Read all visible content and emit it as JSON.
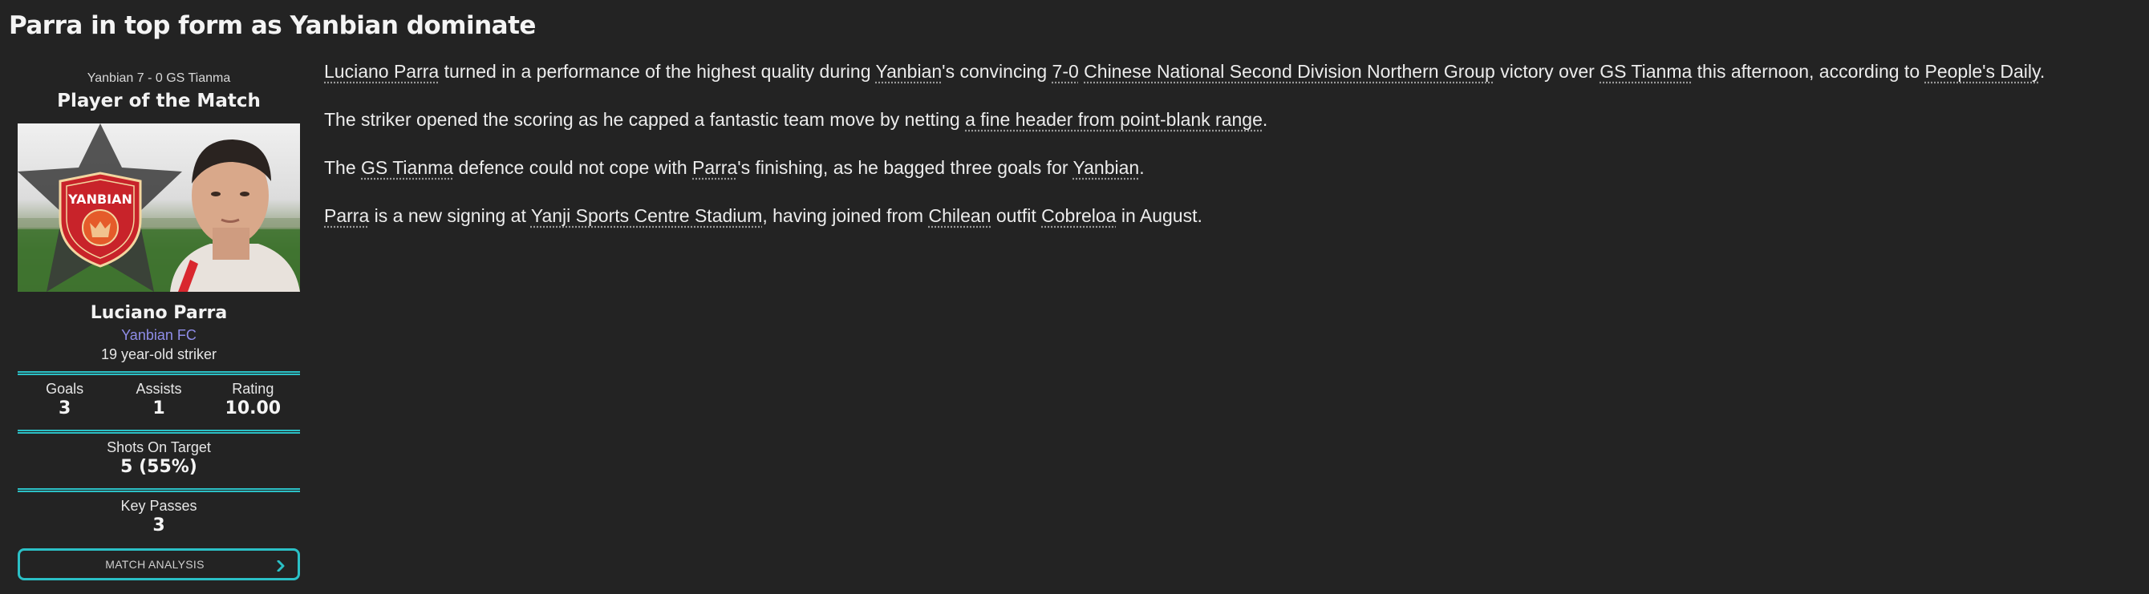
{
  "headline": "Parra in top form as Yanbian dominate",
  "sidebar": {
    "score_line": "Yanbian 7 - 0 GS Tianma",
    "award_title": "Player of the Match",
    "badge_text": "YANBIAN",
    "player_name": "Luciano Parra",
    "club": "Yanbian FC",
    "description": "19 year-old striker",
    "stats": {
      "goals_label": "Goals",
      "goals_value": "3",
      "assists_label": "Assists",
      "assists_value": "1",
      "rating_label": "Rating",
      "rating_value": "10.00",
      "shots_label": "Shots On Target",
      "shots_value": "5 (55%)",
      "key_passes_label": "Key Passes",
      "key_passes_value": "3"
    },
    "match_analysis_label": "MATCH ANALYSIS"
  },
  "article": {
    "p1": {
      "player": "Luciano Parra",
      "t1": " turned in a performance of the highest quality during ",
      "club": "Yanbian",
      "t2": "'s convincing ",
      "score": "7-0",
      "t3": " ",
      "competition": "Chinese National Second Division Northern Group",
      "t4": " victory over ",
      "opponent": "GS Tianma",
      "t5": " this afternoon, according to ",
      "source": "People's Daily",
      "t6": "."
    },
    "p2": {
      "t1": "The striker opened the scoring as he capped a fantastic team move by netting ",
      "goal_link": "a fine header from point-blank range",
      "t2": "."
    },
    "p3": {
      "t1": "The ",
      "opponent": "GS Tianma",
      "t2": " defence could not cope with ",
      "player": "Parra",
      "t3": "'s finishing, as he bagged three goals for ",
      "club": "Yanbian",
      "t4": "."
    },
    "p4": {
      "player": "Parra",
      "t1": " is a new signing at ",
      "stadium": "Yanji Sports Centre Stadium",
      "t2": ", having joined from ",
      "nation": "Chilean",
      "t3": " outfit ",
      "former_club": "Cobreloa",
      "t4": " in August."
    }
  },
  "colors": {
    "background": "#232323",
    "accent": "#2bc0c6",
    "club_link": "#8f8de8",
    "badge_red": "#d42a2a"
  },
  "icons": {
    "badge": "club-crest-icon",
    "star": "star-icon",
    "chevron": "chevron-right-icon"
  }
}
